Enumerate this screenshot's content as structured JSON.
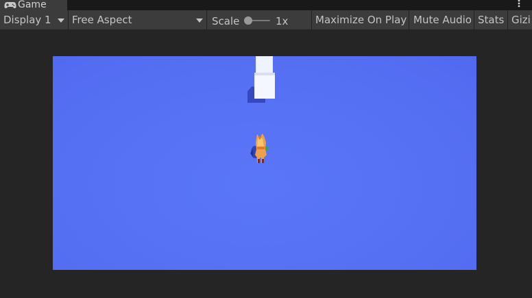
{
  "tab": {
    "icon": "gamepad-icon",
    "label": "Game"
  },
  "menu": {
    "icon": "kebab-menu-icon"
  },
  "toolbar": {
    "display": "Display 1",
    "aspect": "Free Aspect",
    "scale_label": "Scale",
    "scale_value": "1x",
    "scale_level": 0.0,
    "maximize": "Maximize On Play",
    "mute": "Mute Audio",
    "stats": "Stats",
    "gizmos": "Gizi"
  },
  "colors": {
    "editor_bg": "#191919",
    "toolbar_bg": "#3c3c3c",
    "viewport_bg": "#5670f4",
    "cube": "#f4f7ff",
    "character": "#f0a04a"
  }
}
